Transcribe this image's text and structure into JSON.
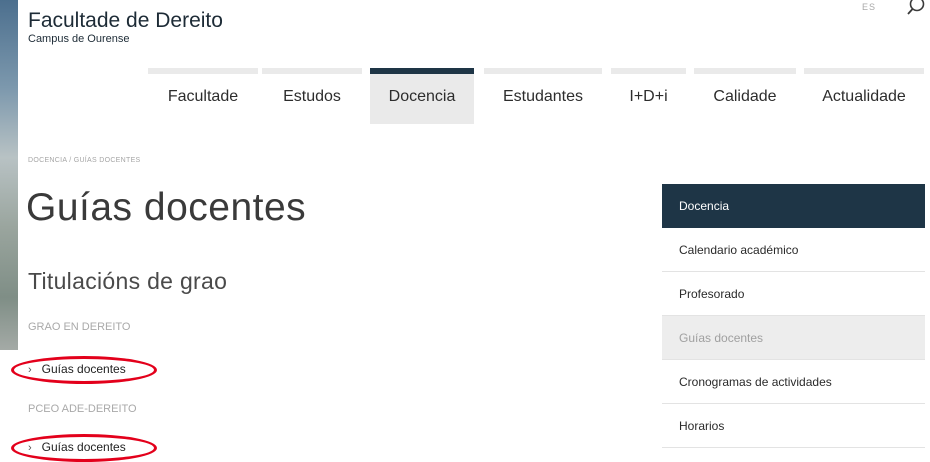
{
  "site": {
    "title": "Facultade de Dereito",
    "subtitle": "Campus de Ourense",
    "lang": "ES"
  },
  "nav": [
    {
      "label": "Facultade",
      "active": false
    },
    {
      "label": "Estudos",
      "active": false
    },
    {
      "label": "Docencia",
      "active": true
    },
    {
      "label": "Estudantes",
      "active": false
    },
    {
      "label": "I+D+i",
      "active": false
    },
    {
      "label": "Calidade",
      "active": false
    },
    {
      "label": "Actualidade",
      "active": false
    }
  ],
  "breadcrumb": "DOCENCIA  /  GUÍAS DOCENTES",
  "page": {
    "title": "Guías docentes",
    "section_title": "Titulacións de grao",
    "groups": [
      {
        "label": "GRAO EN DEREITO",
        "link": "Guías docentes"
      },
      {
        "label": "PCEO ADE-DEREITO",
        "link": "Guías docentes"
      }
    ]
  },
  "sidebar": {
    "header": "Docencia",
    "items": [
      {
        "label": "Calendario académico",
        "current": false
      },
      {
        "label": "Profesorado",
        "current": false
      },
      {
        "label": "Guías docentes",
        "current": true
      },
      {
        "label": "Cronogramas de actividades",
        "current": false
      },
      {
        "label": "Horarios",
        "current": false
      }
    ]
  },
  "colors": {
    "nav_active": "#1e3546",
    "annotation": "#e3001b"
  },
  "icons": {
    "search": "search-icon",
    "chevron": "chevron-right-icon"
  }
}
